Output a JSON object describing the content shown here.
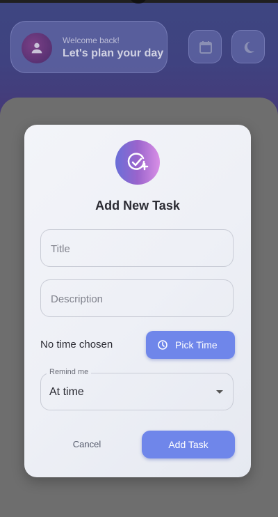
{
  "header": {
    "welcome_small": "Welcome back!",
    "welcome_big": "Let's plan your day",
    "icons": [
      "person-icon",
      "calendar-icon",
      "moon-icon"
    ]
  },
  "dialog": {
    "title": "Add New Task",
    "icon": "task-add-icon",
    "title_field": {
      "placeholder": "Title",
      "value": ""
    },
    "description_field": {
      "placeholder": "Description",
      "value": ""
    },
    "time_status": "No time chosen",
    "pick_time_label": "Pick Time",
    "remind": {
      "label": "Remind me",
      "value": "At time"
    },
    "cancel_label": "Cancel",
    "add_label": "Add Task"
  },
  "colors": {
    "accent": "#6f86ea",
    "header_bg": "#3f4280",
    "dialog_bg": "#eef0f6",
    "overlay": "#6b6b6b"
  }
}
